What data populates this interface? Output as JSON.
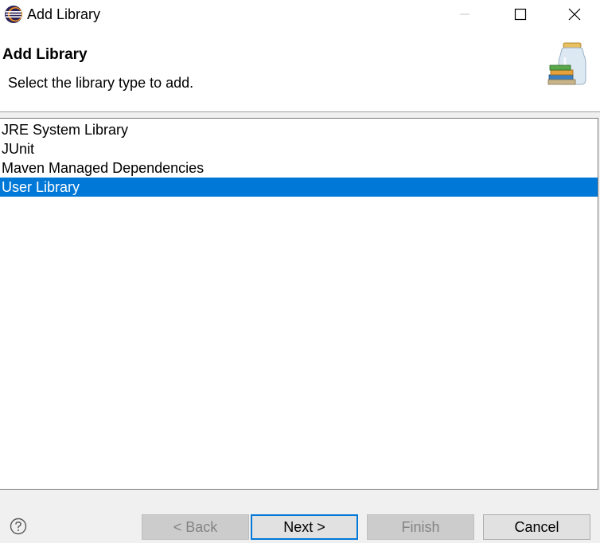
{
  "window": {
    "title": "Add Library"
  },
  "header": {
    "title": "Add Library",
    "description": "Select the library type to add."
  },
  "library_types": {
    "items": [
      {
        "label": "JRE System Library",
        "selected": false
      },
      {
        "label": "JUnit",
        "selected": false
      },
      {
        "label": "Maven Managed Dependencies",
        "selected": false
      },
      {
        "label": "User Library",
        "selected": true
      }
    ]
  },
  "footer": {
    "back_label": "< Back",
    "next_label": "Next >",
    "finish_label": "Finish",
    "cancel_label": "Cancel"
  },
  "colors": {
    "selection": "#0078d7",
    "default_button_border": "#0078d7"
  }
}
